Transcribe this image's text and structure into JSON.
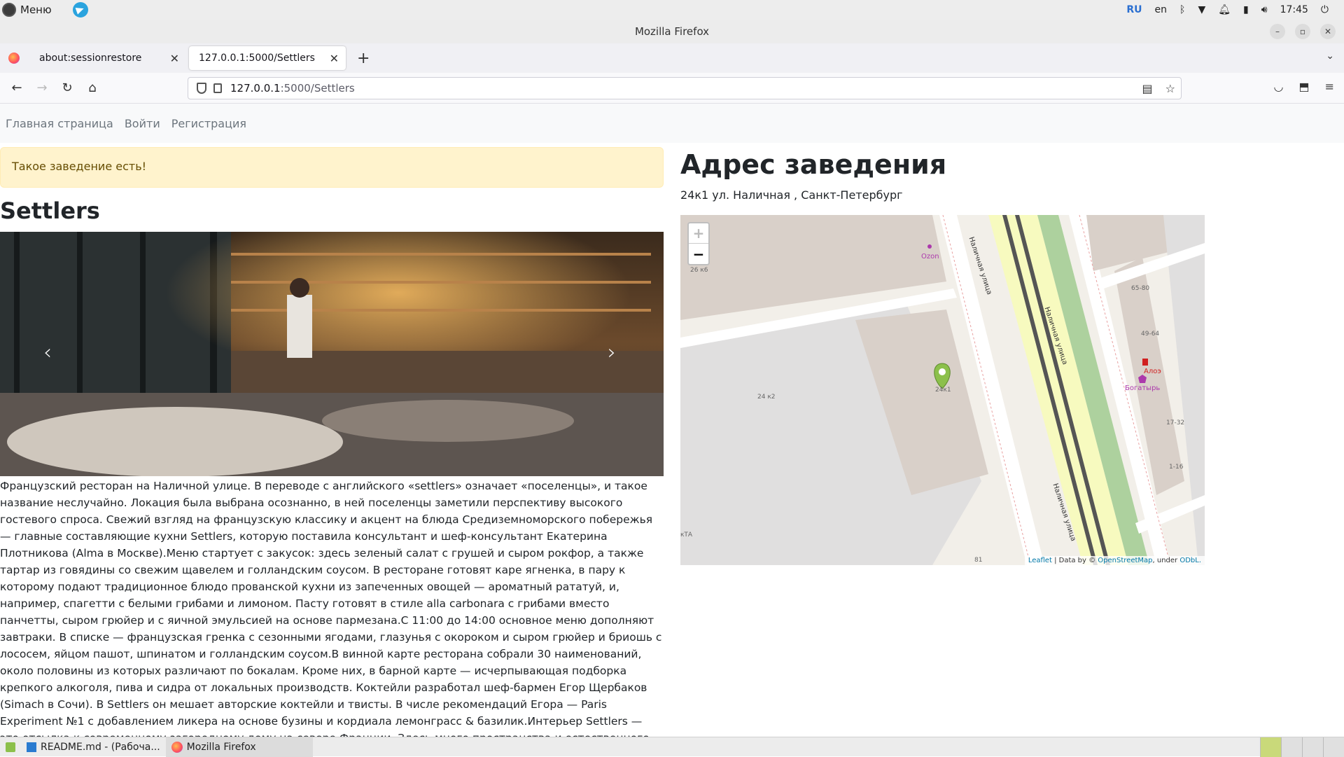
{
  "os": {
    "menu_label": "Меню",
    "lang_ru": "RU",
    "lang_en": "en",
    "clock": "17:45"
  },
  "window": {
    "title": "Mozilla Firefox"
  },
  "tabs": [
    {
      "label": "about:sessionrestore"
    },
    {
      "label": "127.0.0.1:5000/Settlers"
    }
  ],
  "url": {
    "host": "127.0.0.1",
    "path": ":5000/Settlers"
  },
  "site_nav": {
    "home": "Главная страница",
    "login": "Войти",
    "register": "Регистрация"
  },
  "alert": "Такое заведение есть!",
  "place": {
    "name": "Settlers",
    "description": "Французский ресторан на Наличной улице. В переводе с английского «settlers» означает «поселенцы», и такое название неслучайно. Локация была выбрана осознанно, в ней поселенцы заметили перспективу высокого гостевого спроса. Свежий взгляд на французскую классику и акцент на блюда Средиземноморского побережья — главные составляющие кухни Settlers, которую поставила консультант и шеф-консультант Екатерина Плотникова (Alma в Москве).Меню стартует с закусок: здесь зеленый салат с грушей и сыром рокфор, а также тартар из говядины со свежим щавелем и голландским соусом. В ресторане готовят каре ягненка, в пару к которому подают традиционное блюдо прованской кухни из запеченных овощей — ароматный рататуй, и, например, спагетти с белыми грибами и лимоном. Пасту готовят в стиле alla carbonara с грибами вместо панчетты, сыром грюйер и с яичной эмульсией на основе пармезана.С 11:00 до 14:00 основное меню дополняют завтраки. В списке — французская гренка с сезонными ягодами, глазунья с окороком и сыром грюйер и бриошь с лососем, яйцом пашот, шпинатом и голландским соусом.В винной карте ресторана собрали 30 наименований, около половины из которых различают по бокалам. Кроме них, в барной карте — исчерпывающая подборка крепкого алкоголя, пива и сидра от локальных производств. Коктейли разработал шеф-бармен Егор Щербаков (Simach в Сочи). В Settlers он мешает авторские коктейли и твисты. В числе рекомендаций Егора — Paris Experiment №1 с добавлением ликера на основе бузины и кордиала лемонграсс & базилик.Интерьер Settlers — это отсылка к современному загородному дому на севере Франции. Здесь много пространства и естественного света за счет высоких арочных окон, теплая бежевая палитра и натуральные материалы в отделке например, лен и дерево. Акцентными деталями стали открытая кухня и контактная"
  },
  "address": {
    "title": "Адрес заведения",
    "text": "24к1 ул. Наличная , Санкт-Петербург"
  },
  "map": {
    "zoom_in": "+",
    "zoom_out": "−",
    "street_name": "Наличная улица",
    "labels": {
      "ozon": "Ozon",
      "b26k6": "26 к6",
      "b24k2": "24 к2",
      "b24k1": "24к1",
      "b65_80": "65-80",
      "b49_64": "49-64",
      "b17_32": "17-32",
      "b1_16": "1-16",
      "aloe": "Алоэ",
      "bogatyr": "Богатырь",
      "b81": "81",
      "kta": "кТА"
    },
    "attribution": {
      "leaflet": "Leaflet",
      "data_by": " | Data by © ",
      "osm": "OpenStreetMap",
      "under": ", under ",
      "odbl": "ODbL."
    }
  },
  "taskbar": {
    "readme": "README.md - (Рабоча...",
    "firefox": "Mozilla Firefox"
  }
}
